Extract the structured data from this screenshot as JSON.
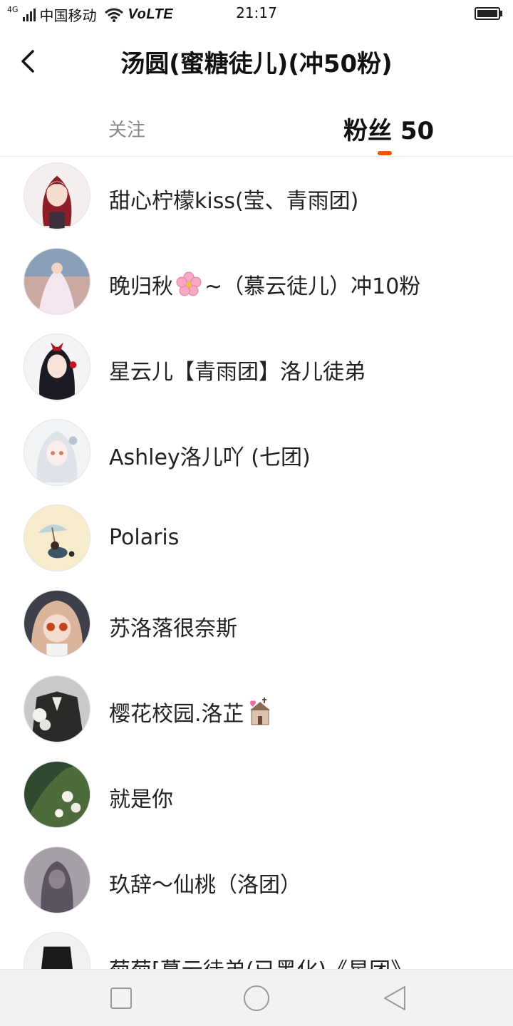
{
  "status_bar": {
    "network_type": "4G",
    "carrier": "中国移动",
    "volte": "VoLTE",
    "time": "21:17"
  },
  "header": {
    "title": "汤圆(蜜糖徒儿)(冲50粉)",
    "back_icon": "chevron-left-icon"
  },
  "tabs": {
    "follow_label": "关注",
    "fans_label": "粉丝 50",
    "accent_color": "#ff5000"
  },
  "fans": [
    {
      "name": "甜心柠檬kiss(莹、青雨团)"
    },
    {
      "name": "晚归秋",
      "emoji": "cherry-blossom-icon",
      "suffix": "~（慕云徒儿）冲10粉"
    },
    {
      "name": "星云儿【青雨团】洛儿徒弟"
    },
    {
      "name": "Ashley洛儿吖 (七团)"
    },
    {
      "name": "Polaris"
    },
    {
      "name": "苏洛落很奈斯"
    },
    {
      "name": "樱花校园.洛芷",
      "emoji": "wedding-chapel-icon",
      "suffix": ""
    },
    {
      "name": "就是你"
    },
    {
      "name": "玖辞～仙桃（洛团）"
    },
    {
      "name": "菊菊[慕云徒弟(已黑化)《星团》"
    }
  ],
  "nav_bar": {
    "recent_icon": "square-icon",
    "home_icon": "circle-icon",
    "back_icon": "triangle-back-icon"
  }
}
